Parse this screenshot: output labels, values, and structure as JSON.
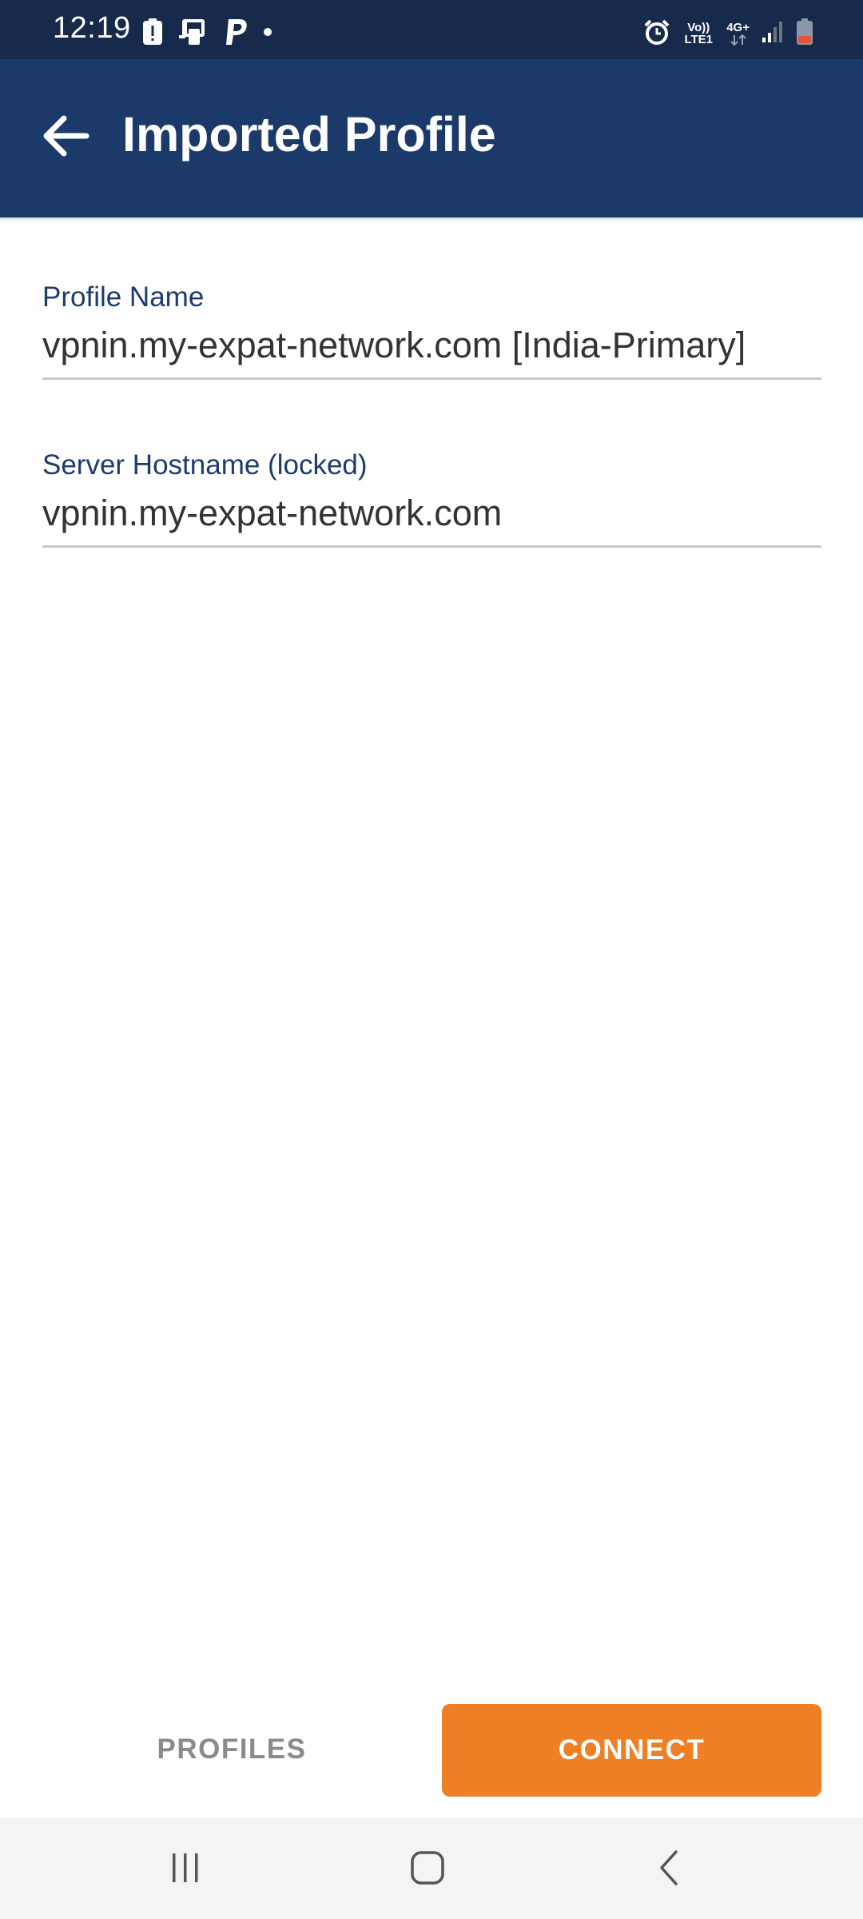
{
  "status_bar": {
    "time": "12:19",
    "network_volte": "Vo)) LTE1",
    "network_type": "4G+",
    "left_icons": [
      "alert-icon",
      "sim-card-icon",
      "paypal-icon",
      "dot-icon"
    ],
    "right_icons": [
      "alarm-icon",
      "volte-icon",
      "data-icon",
      "signal-icon",
      "battery-low-icon"
    ]
  },
  "app_bar": {
    "title": "Imported Profile",
    "back_icon": "arrow-back-icon",
    "background": "#1c3a69"
  },
  "form": {
    "profile_name": {
      "label": "Profile Name",
      "value": "vpnin.my-expat-network.com [India-Primary]"
    },
    "server_hostname": {
      "label": "Server Hostname (locked)",
      "value": "vpnin.my-expat-network.com"
    }
  },
  "actions": {
    "profiles_label": "PROFILES",
    "connect_label": "CONNECT",
    "connect_color": "#ee7f24"
  },
  "nav_bar": {
    "icons": [
      "recent-apps-icon",
      "home-icon",
      "back-icon"
    ]
  }
}
